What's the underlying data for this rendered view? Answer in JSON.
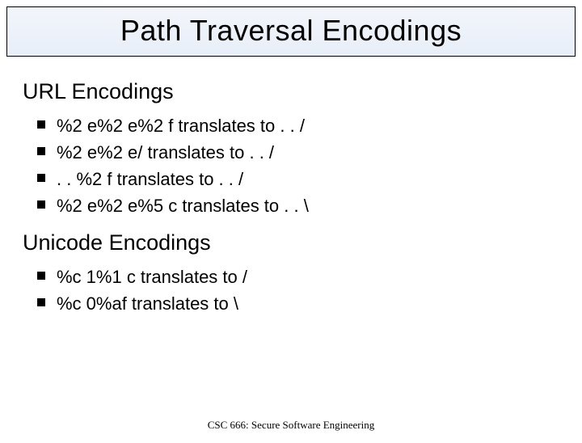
{
  "title": "Path Traversal Encodings",
  "sections": [
    {
      "heading": "URL Encodings",
      "items": [
        "%2 e%2 e%2 f translates to . . /",
        "%2 e%2 e/ translates to . . /",
        ". . %2 f translates to . . /",
        "%2 e%2 e%5 c translates to . . \\"
      ]
    },
    {
      "heading": "Unicode Encodings",
      "items": [
        "%c 1%1 c translates to /",
        "%c 0%af translates to \\"
      ]
    }
  ],
  "footer": "CSC 666: Secure Software Engineering"
}
